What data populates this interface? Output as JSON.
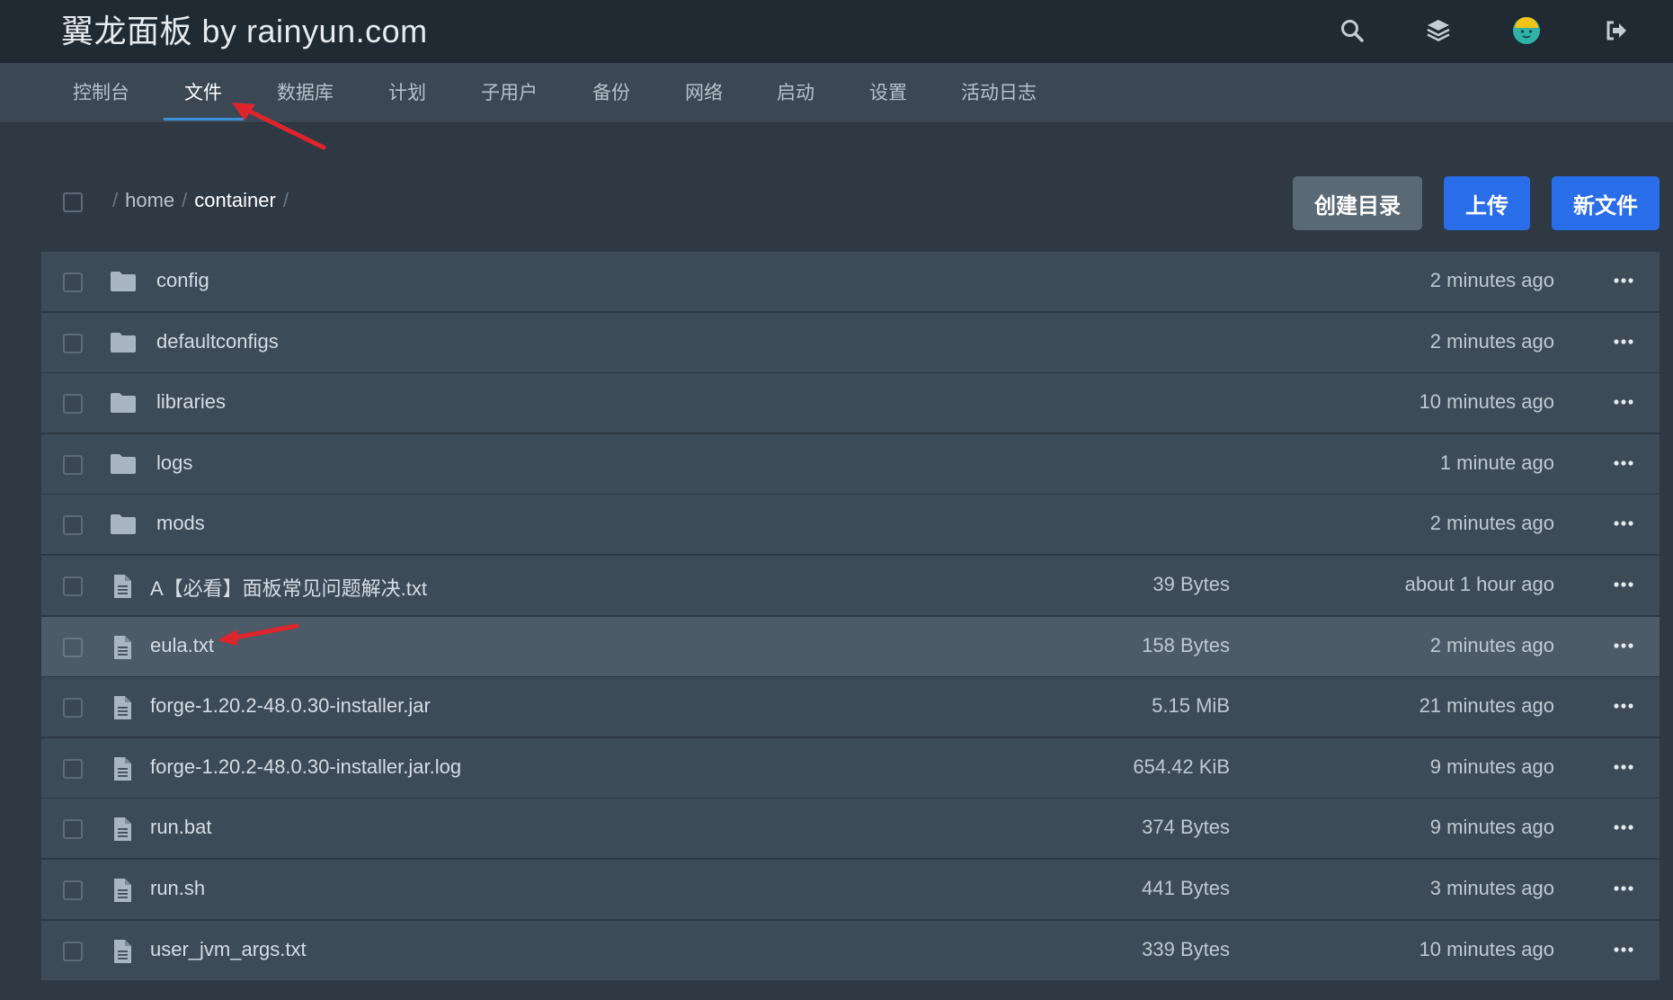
{
  "header": {
    "brand": "翼龙面板 by rainyun.com",
    "icons": [
      "search-icon",
      "layers-icon",
      "avatar",
      "logout-icon"
    ]
  },
  "nav": {
    "items": [
      {
        "label": "控制台"
      },
      {
        "label": "文件",
        "active": true
      },
      {
        "label": "数据库"
      },
      {
        "label": "计划"
      },
      {
        "label": "子用户"
      },
      {
        "label": "备份"
      },
      {
        "label": "网络"
      },
      {
        "label": "启动"
      },
      {
        "label": "设置"
      },
      {
        "label": "活动日志"
      }
    ]
  },
  "breadcrumb": {
    "parts": [
      "home",
      "container"
    ],
    "sep": "/"
  },
  "actions": {
    "create_dir": "创建目录",
    "upload": "上传",
    "new_file": "新文件"
  },
  "files": [
    {
      "type": "folder",
      "name": "config",
      "size": "",
      "modified": "2 minutes ago"
    },
    {
      "type": "folder",
      "name": "defaultconfigs",
      "size": "",
      "modified": "2 minutes ago"
    },
    {
      "type": "folder",
      "name": "libraries",
      "size": "",
      "modified": "10 minutes ago"
    },
    {
      "type": "folder",
      "name": "logs",
      "size": "",
      "modified": "1 minute ago"
    },
    {
      "type": "folder",
      "name": "mods",
      "size": "",
      "modified": "2 minutes ago"
    },
    {
      "type": "file",
      "name": "A【必看】面板常见问题解决.txt",
      "size": "39 Bytes",
      "modified": "about 1 hour ago"
    },
    {
      "type": "file",
      "name": "eula.txt",
      "size": "158 Bytes",
      "modified": "2 minutes ago",
      "highlight": true
    },
    {
      "type": "file",
      "name": "forge-1.20.2-48.0.30-installer.jar",
      "size": "5.15 MiB",
      "modified": "21 minutes ago"
    },
    {
      "type": "file",
      "name": "forge-1.20.2-48.0.30-installer.jar.log",
      "size": "654.42 KiB",
      "modified": "9 minutes ago"
    },
    {
      "type": "file",
      "name": "run.bat",
      "size": "374 Bytes",
      "modified": "9 minutes ago"
    },
    {
      "type": "file",
      "name": "run.sh",
      "size": "441 Bytes",
      "modified": "3 minutes ago"
    },
    {
      "type": "file",
      "name": "user_jvm_args.txt",
      "size": "339 Bytes",
      "modified": "10 minutes ago"
    }
  ],
  "colors": {
    "accent": "#2a6de8",
    "annotation_arrow": "#e0242b"
  }
}
